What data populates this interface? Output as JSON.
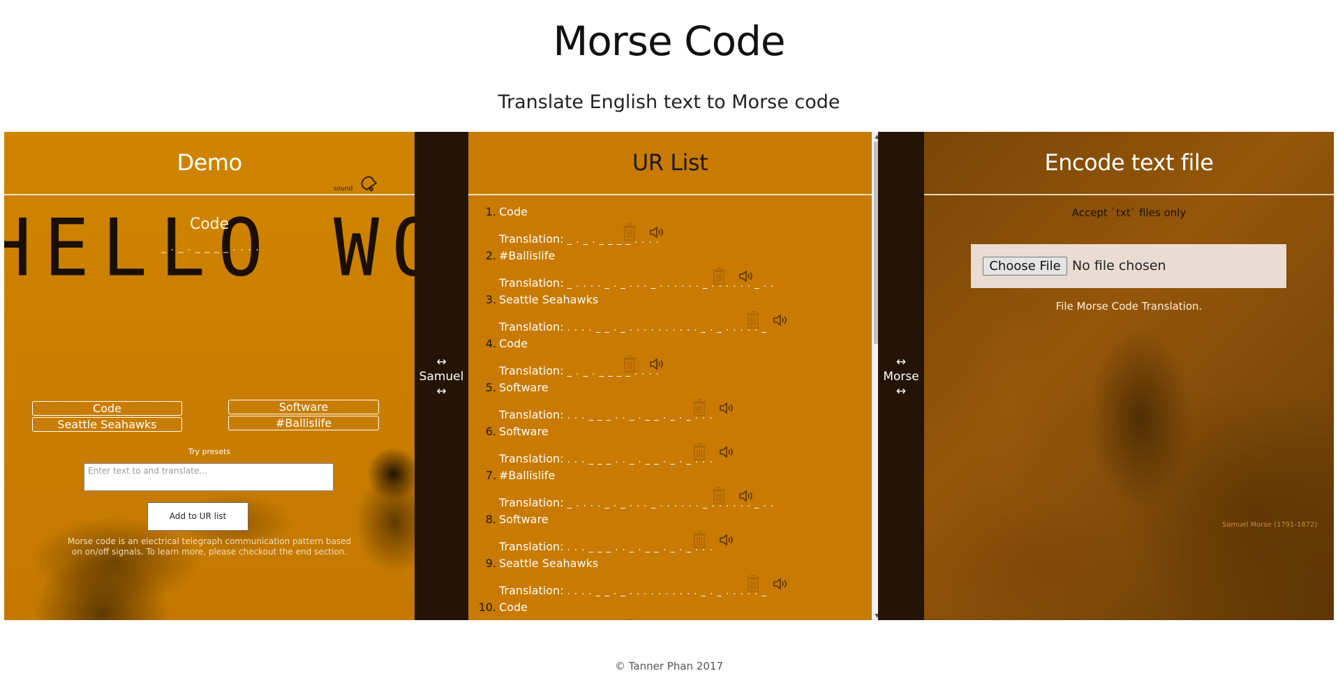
{
  "header": {
    "title": "Morse Code",
    "subtitle": "Translate English text to Morse code"
  },
  "demo": {
    "title": "Demo",
    "background_text": "HELLO WORLD",
    "sound_label": "sound",
    "sound_icon": "bell-icon",
    "current_word": "Code",
    "current_morse": "_ . _ . _ _ _ _ . . . .",
    "presets": [
      "Code",
      "Software",
      "Seattle Seahawks",
      "#Ballislife"
    ],
    "try_presets_label": "Try presets",
    "input_placeholder": "Enter text to and translate...",
    "add_button_label": "Add to UR list",
    "description": "Morse code is an electrical telegraph communication pattern based on on/off signals. To learn more, please checkout the end section."
  },
  "sidebar_left": {
    "arrow_top": "↔",
    "label": "Samuel",
    "arrow_bottom": "↔"
  },
  "sidebar_right": {
    "arrow_top": "↔",
    "label": "Morse",
    "arrow_bottom": "↔"
  },
  "urlist": {
    "title": "UR List",
    "translation_label": "Translation:",
    "items": [
      {
        "num": "1.",
        "name": "Code",
        "morse": "_ . _ . _ _ _ _ . . . ."
      },
      {
        "num": "2.",
        "name": "#Ballislife",
        "morse": "_ . . . . _ . _ . . . _ . . . . . . _ . . . . . . _ . ."
      },
      {
        "num": "3.",
        "name": "Seattle Seahawks",
        "morse": ". . . . _ _ . _ . . . . . . . . . . _ . _ . . . . . _"
      },
      {
        "num": "4.",
        "name": "Code",
        "morse": "_ . _ . _ _ _ _ . . . ."
      },
      {
        "num": "5.",
        "name": "Software",
        "morse": ". . . _ _ _ . . _ . _ _ . _ . _ . . ."
      },
      {
        "num": "6.",
        "name": "Software",
        "morse": ". . . _ _ _ . . _ . _ _ . _ . _ . . ."
      },
      {
        "num": "7.",
        "name": "#Ballislife",
        "morse": "_ . . . . _ . _ . . . _ . . . . . . _ . . . . . . _ . ."
      },
      {
        "num": "8.",
        "name": "Software",
        "morse": ". . . _ _ _ . . _ . _ _ . _ . _ . . ."
      },
      {
        "num": "9.",
        "name": "Seattle Seahawks",
        "morse": ". . . . _ _ . _ . . . . . . . . . . _ . _ . . . . . _"
      },
      {
        "num": "10.",
        "name": "Code",
        "morse": "_ . _ . _ _ _ _ . . . ."
      }
    ]
  },
  "encode": {
    "title": "Encode text file",
    "accept_note": "Accept `txt` files only",
    "choose_file_label": "Choose File",
    "no_file_label": "No file chosen",
    "result_label": "File Morse Code Translation.",
    "image_credit": "Samuel Morse (1791-1872)"
  },
  "footer": {
    "text": "© Tanner Phan 2017"
  },
  "colors": {
    "panel_orange": "#c97a00",
    "sidebar_dark": "#231405",
    "encode_brown": "#7a4606"
  }
}
